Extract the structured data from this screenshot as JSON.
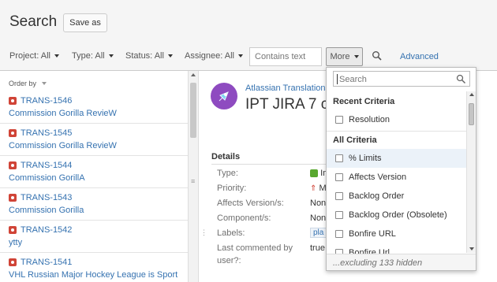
{
  "header": {
    "title": "Search",
    "save_as_label": "Save as"
  },
  "filters": {
    "project": "Project: All",
    "type": "Type: All",
    "status": "Status: All",
    "assignee": "Assignee: All",
    "text_placeholder": "Contains text",
    "more_label": "More",
    "advanced_label": "Advanced"
  },
  "list": {
    "order_by": "Order by",
    "issues": [
      {
        "key": "TRANS-1546",
        "summary": "Commission Gorilla RevieW"
      },
      {
        "key": "TRANS-1545",
        "summary": "Commission Gorilla RevieW"
      },
      {
        "key": "TRANS-1544",
        "summary": "Commission GorillA"
      },
      {
        "key": "TRANS-1543",
        "summary": "Commission Gorilla"
      },
      {
        "key": "TRANS-1542",
        "summary": "ytty"
      },
      {
        "key": "TRANS-1541",
        "summary": "VHL Russian Major Hockey League is Sport"
      }
    ]
  },
  "detail": {
    "project": "Atlassian Translations",
    "title": "IPT JIRA 7 c",
    "section_heading": "Details",
    "fields": {
      "type_label": "Type:",
      "type_value": "Im",
      "priority_label": "Priority:",
      "priority_value": "M",
      "affects_label": "Affects Version/s:",
      "affects_value": "Non",
      "component_label": "Component/s:",
      "component_value": "Non",
      "labels_label": "Labels:",
      "labels_value": "pla",
      "last_commented_label_1": "Last commented by",
      "last_commented_label_2": "user?:",
      "last_commented_value": "true"
    }
  },
  "more_dropdown": {
    "search_placeholder": "Search",
    "recent_heading": "Recent Criteria",
    "recent_items": [
      "Resolution"
    ],
    "all_heading": "All Criteria",
    "all_items": [
      "% Limits",
      "Affects Version",
      "Backlog Order",
      "Backlog Order (Obsolete)",
      "Bonfire URL",
      "Bonfire Url"
    ],
    "footer": "...excluding 133 hidden"
  },
  "colors": {
    "link": "#3572b0",
    "bug": "#d04437",
    "avatar": "#8e4bc0",
    "hover": "#ebf2f9"
  }
}
